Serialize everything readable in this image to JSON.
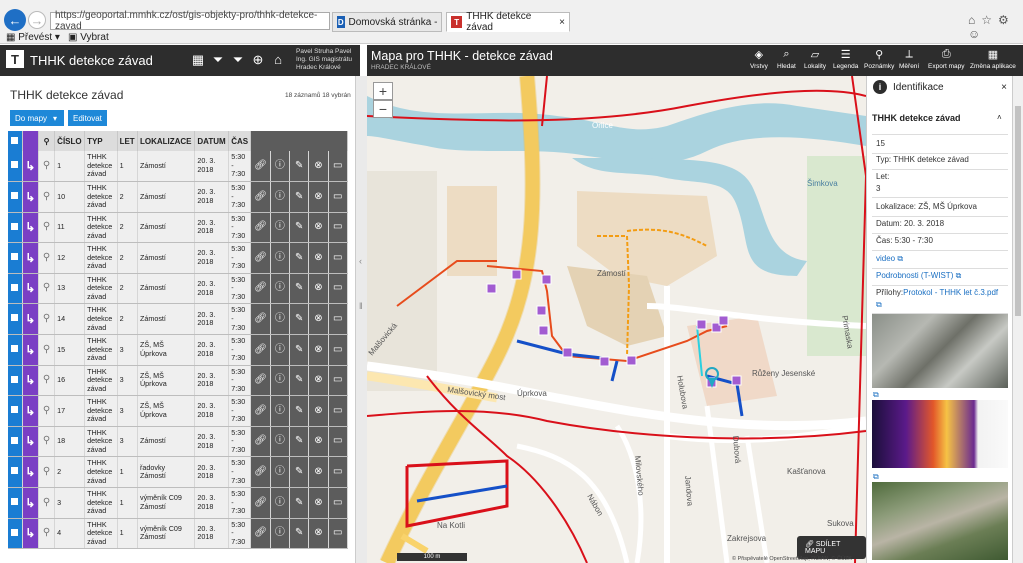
{
  "browser": {
    "url": "https://geoportal.mmhk.cz/ost/gis-objekty-pro/thhk-detekce-zavad",
    "tabs": [
      {
        "label": "Domovská stránka - INTRANET",
        "active": false
      },
      {
        "label": "THHK detekce závad",
        "active": true
      }
    ],
    "toolbar": {
      "prevest": "Převést",
      "vybrat": "Vybrat"
    }
  },
  "app": {
    "title": "THHK detekce závad",
    "user": "Pavel Struha Pavel Ing. GIS magistrátu Hradec Králové"
  },
  "list": {
    "title": "THHK detekce závad",
    "counts": "18 záznamů 18 vybrán",
    "btn_do_mapy": "Do mapy",
    "btn_editovat": "Editovat",
    "columns": [
      "ČÍSLO",
      "TYP",
      "LET",
      "LOKALIZACE",
      "DATUM",
      "ČAS"
    ],
    "rows": [
      {
        "cislo": "1",
        "typ": "THHK detekce závad",
        "let": "1",
        "lok": "Zámostí",
        "datum": "20. 3. 2018",
        "cas": "5:30 - 7:30"
      },
      {
        "cislo": "10",
        "typ": "THHK detekce závad",
        "let": "2",
        "lok": "Zámostí",
        "datum": "20. 3. 2018",
        "cas": "5:30 - 7:30"
      },
      {
        "cislo": "11",
        "typ": "THHK detekce závad",
        "let": "2",
        "lok": "Zámostí",
        "datum": "20. 3. 2018",
        "cas": "5:30 - 7:30"
      },
      {
        "cislo": "12",
        "typ": "THHK detekce závad",
        "let": "2",
        "lok": "Zámostí",
        "datum": "20. 3. 2018",
        "cas": "5:30 - 7:30"
      },
      {
        "cislo": "13",
        "typ": "THHK detekce závad",
        "let": "2",
        "lok": "Zámostí",
        "datum": "20. 3. 2018",
        "cas": "5:30 - 7:30"
      },
      {
        "cislo": "14",
        "typ": "THHK detekce závad",
        "let": "2",
        "lok": "Zámostí",
        "datum": "20. 3. 2018",
        "cas": "5:30 - 7:30"
      },
      {
        "cislo": "15",
        "typ": "THHK detekce závad",
        "let": "3",
        "lok": "ZŠ, MŠ Úprkova",
        "datum": "20. 3. 2018",
        "cas": "5:30 - 7:30"
      },
      {
        "cislo": "16",
        "typ": "THHK detekce závad",
        "let": "3",
        "lok": "ZŠ, MŠ Úprkova",
        "datum": "20. 3. 2018",
        "cas": "5:30 - 7:30"
      },
      {
        "cislo": "17",
        "typ": "THHK detekce závad",
        "let": "3",
        "lok": "ZŠ, MŠ Úprkova",
        "datum": "20. 3. 2018",
        "cas": "5:30 - 7:30"
      },
      {
        "cislo": "18",
        "typ": "THHK detekce závad",
        "let": "3",
        "lok": "Zámostí",
        "datum": "20. 3. 2018",
        "cas": "5:30 - 7:30"
      },
      {
        "cislo": "2",
        "typ": "THHK detekce závad",
        "let": "1",
        "lok": "řadovky Zámostí",
        "datum": "20. 3. 2018",
        "cas": "5:30 - 7:30"
      },
      {
        "cislo": "3",
        "typ": "THHK detekce závad",
        "let": "1",
        "lok": "výměník C09 Zámostí",
        "datum": "20. 3. 2018",
        "cas": "5:30 - 7:30"
      },
      {
        "cislo": "4",
        "typ": "THHK detekce závad",
        "let": "1",
        "lok": "výměník C09 Zámostí",
        "datum": "20. 3. 2018",
        "cas": "5:30 - 7:30"
      }
    ]
  },
  "map": {
    "title": "Mapa pro THHK - detekce závad",
    "subtitle": "HRADEC KRÁLOVÉ",
    "tools": [
      "Vrstvy",
      "Hledat",
      "Lokality",
      "Legenda",
      "Poznámky",
      "Měření",
      "Export mapy",
      "Změna aplikace"
    ],
    "share": "SDÍLET MAPU",
    "scale": "100 m",
    "attribution": "© Přispěvatelé OpenStreetMap, RÚIAN, © ČÚZK",
    "labels": [
      "Zámostí",
      "Orlice",
      "Úprkova",
      "Malšovický most",
      "Malšovická",
      "Holubova",
      "Růženy Jesenské",
      "Na Kotli",
      "Nábon",
      "Milovského",
      "Jandova",
      "Dubová",
      "Kašťanova",
      "Sukova",
      "Zakrejsova",
      "Šimkova",
      "Primaska"
    ]
  },
  "ident": {
    "title": "Identifikace",
    "section": "THHK detekce závad",
    "id": "15",
    "typ": "Typ: THHK detekce závad",
    "let_label": "Let:",
    "let": "3",
    "lokalizace": "Lokalizace: ZŠ, MŠ Úprkova",
    "datum": "Datum: 20. 3. 2018",
    "cas": "Čas: 5:30 - 7:30",
    "video": "video",
    "podrobnosti": "Podrobnosti (T-WIST)",
    "prilohy_label": "Přílohy:",
    "prilohy_link": "Protokol - THHK let č.3.pdf"
  }
}
